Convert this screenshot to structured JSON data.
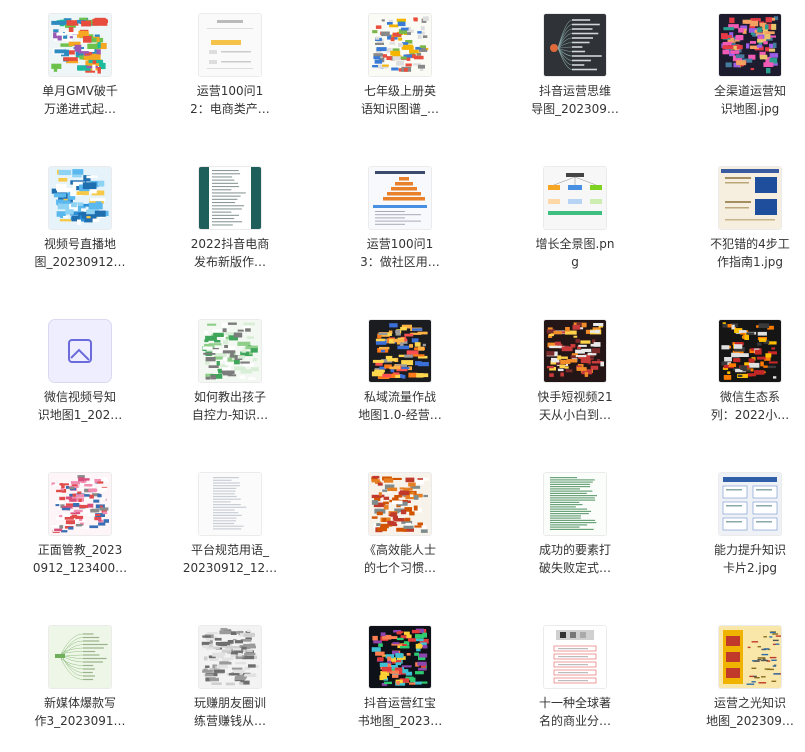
{
  "items": [
    {
      "label": "单月GMV破千\n万递进式起…",
      "thumb": "mindmap-colorful"
    },
    {
      "label": "运营100问1\n2：电商类产…",
      "thumb": "doc-light"
    },
    {
      "label": "七年级上册英\n语知识图谱_…",
      "thumb": "table-colorful"
    },
    {
      "label": "抖音运营思维\n导图_202309…",
      "thumb": "mindmap-dark"
    },
    {
      "label": "全渠道运营知\n识地图.jpg",
      "thumb": "dark-colorful"
    },
    {
      "label": "视频号直播地\n图_20230912…",
      "thumb": "blue-map"
    },
    {
      "label": "2022抖音电商\n发布新版作…",
      "thumb": "teal-doc"
    },
    {
      "label": "运营100问1\n3：做社区用…",
      "thumb": "orange-stairs"
    },
    {
      "label": "增长全景图.pn\ng",
      "thumb": "flowchart"
    },
    {
      "label": "不犯错的4步工\n作指南1.jpg",
      "thumb": "beige-cards"
    },
    {
      "label": "微信视频号知\n识地图1_202…",
      "thumb": "placeholder"
    },
    {
      "label": "如何教出孩子\n自控力-知识…",
      "thumb": "green-table"
    },
    {
      "label": "私域流量作战\n地图1.0-经营…",
      "thumb": "dark-orange"
    },
    {
      "label": "快手短视频21\n天从小白到…",
      "thumb": "dark-red"
    },
    {
      "label": "微信生态系\n列：2022小…",
      "thumb": "dark-yellow"
    },
    {
      "label": "正面管教_2023\n0912_123400…",
      "thumb": "pink-dense"
    },
    {
      "label": "平台规范用语_\n20230912_12…",
      "thumb": "gray-lines"
    },
    {
      "label": "《高效能人士\n的七个习惯…",
      "thumb": "red-mindmap"
    },
    {
      "label": "成功的要素打\n破失败定式…",
      "thumb": "green-text"
    },
    {
      "label": "能力提升知识\n卡片2.jpg",
      "thumb": "blue-cards"
    },
    {
      "label": "新媒体爆款写\n作3_2023091…",
      "thumb": "light-green-map"
    },
    {
      "label": "玩赚朋友圈训\n练营赚钱从…",
      "thumb": "gray-dense"
    },
    {
      "label": "抖音运营红宝\n书地图_2023…",
      "thumb": "dark-multi"
    },
    {
      "label": "十一种全球著\n名的商业分…",
      "thumb": "white-boxes"
    },
    {
      "label": "运营之光知识\n地图_202309…",
      "thumb": "yellow-poster"
    }
  ]
}
